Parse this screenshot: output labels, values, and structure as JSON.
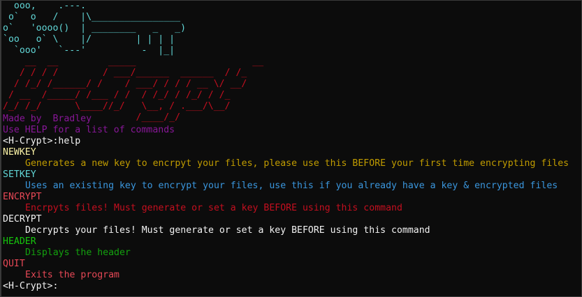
{
  "colors": {
    "background": "#0c0c0c",
    "default_text": "#cccccc",
    "key_art": "#61d6d6",
    "title_art": "#c50f1f",
    "purple": "#881798",
    "white": "#f2f2f2",
    "yellow": "#c19c00",
    "cyan": "#3a96dd",
    "red": "#e74856",
    "green": "#13a10e"
  },
  "key_art": "  ooo,    .---.\n o`  o   /    |\\________________\no`   'oooo()  | ________   _   _)\n`oo   o` \\    |/        | | | |\n  `ooo'   `---'          -  |_|",
  "title_art": "    __  __         _____                     __ \n   / / / /        / ___/______  ______  / /_\n  / /_/ /______/ /    / ___/ / / / __ \\/ __/\n / __  /_____/ /___ / /  / /_/ / /_/ / /_  \n/_/ /_/      \\____//_/   \\__, / .___/\\__/  \n                        /____/_/           ",
  "credits": {
    "made_by": "Made by  Bradley",
    "help_hint": "Use HELP for a list of commands"
  },
  "session": {
    "prompt_1": "<H-Crypt>:help",
    "prompt_2": "<H-Crypt>:"
  },
  "commands": [
    {
      "name": "NEWKEY",
      "description": "Generates a new key to encrpyt your files, please use this BEFORE your first time encrypting files"
    },
    {
      "name": "SETKEY",
      "description": "Uses an existing key to encrypt your files, use this if you already have a key & encrypted files"
    },
    {
      "name": "ENCRYPT",
      "description": "Encrpyts files! Must generate or set a key BEFORE using this command"
    },
    {
      "name": "DECRYPT",
      "description": "Decrypts your files! Must generate or set a key BEFORE using this command"
    },
    {
      "name": "HEADER",
      "description": "Displays the header"
    },
    {
      "name": "QUIT",
      "description": "Exits the program"
    }
  ]
}
